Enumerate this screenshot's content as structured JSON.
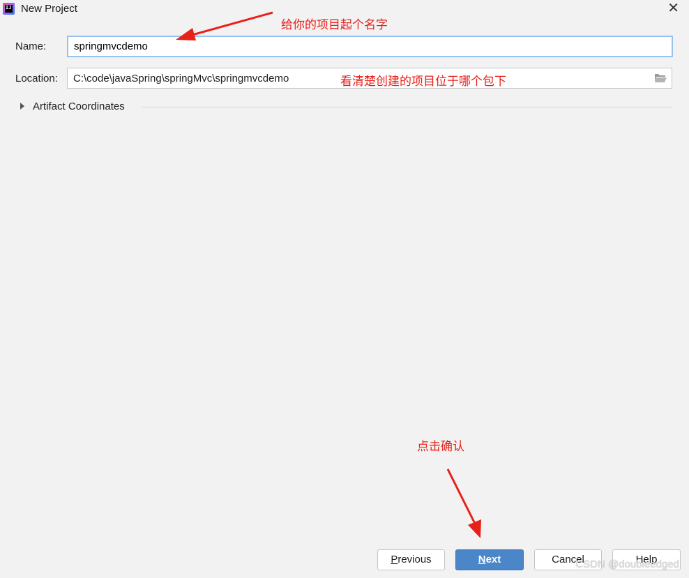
{
  "window": {
    "title": "New Project",
    "app_icon_text": "IJ"
  },
  "form": {
    "name_label": "Name:",
    "name_value": "springmvcdemo",
    "location_label": "Location:",
    "location_value": "C:\\code\\javaSpring\\springMvc\\springmvcdemo",
    "artifact_label": "Artifact Coordinates"
  },
  "annotations": {
    "name_note": "给你的项目起个名字",
    "location_note": "看清楚创建的项目位于哪个包下",
    "next_note": "点击确认",
    "color": "#e8201a"
  },
  "buttons": {
    "previous_first": "P",
    "previous_rest": "revious",
    "next_first": "N",
    "next_rest": "ext",
    "cancel": "Cancel",
    "help": "Help"
  },
  "icons": {
    "close": "close-icon",
    "folder": "folder-icon",
    "expand": "triangle-right-icon"
  },
  "watermark": "CSDN @doubleedged",
  "colors": {
    "background": "#f2f2f2",
    "primary_button": "#4a86c8",
    "focus_border": "#97c3ee"
  }
}
